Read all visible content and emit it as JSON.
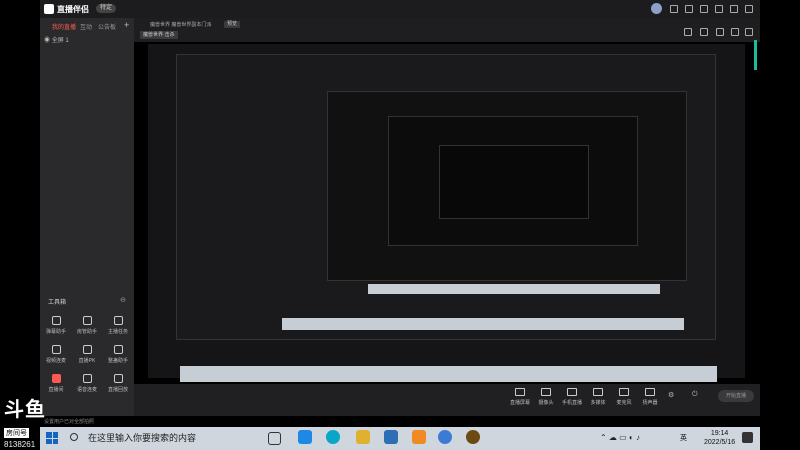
{
  "app": {
    "name": "直播伴侣",
    "version_badge": "特定",
    "preview_badge": "预览"
  },
  "left_tabs": [
    "我的直播",
    "互动",
    "公告板"
  ],
  "scene": {
    "label": "全屏 1"
  },
  "tools_title": "工具箱",
  "tools": [
    {
      "label": "弹幕助手",
      "icon": "danmaku-icon"
    },
    {
      "label": "房管助手",
      "icon": "admin-icon"
    },
    {
      "label": "主播任务",
      "icon": "task-icon"
    },
    {
      "label": "视频连麦",
      "icon": "video-link-icon"
    },
    {
      "label": "直播PK",
      "icon": "pk-icon"
    },
    {
      "label": "整蛊助手",
      "icon": "prank-icon"
    },
    {
      "label": "直播间",
      "icon": "live-room-icon",
      "accent": true
    },
    {
      "label": "语音连麦",
      "icon": "voice-link-icon"
    },
    {
      "label": "直播回放",
      "icon": "replay-icon"
    }
  ],
  "header": {
    "scene_chip": "魔兽世界·击杀",
    "stream_title": "魔兽世界 魔兽世界副本门派"
  },
  "bottom_tools": [
    {
      "label": "直播屏幕",
      "icon": "screen-icon"
    },
    {
      "label": "摄像头",
      "icon": "camera-icon"
    },
    {
      "label": "手机直播",
      "icon": "phone-icon"
    },
    {
      "label": "多媒体",
      "icon": "media-icon"
    },
    {
      "label": "麦克风",
      "icon": "mic-icon"
    },
    {
      "label": "扬声器",
      "icon": "speaker-icon"
    }
  ],
  "start_live": "开始直播",
  "status_line": "设置用户已对全部拍照",
  "watermark": {
    "brand": "斗鱼",
    "sub": "房间号",
    "room": "8138261"
  },
  "taskbar": {
    "search_placeholder": "在这里输入你要搜索的内容",
    "lang": "英",
    "time": "19:14",
    "date": "2022/5/16"
  },
  "colors": {
    "accent": "#ff5a4f",
    "scroll": "#1abc9c",
    "taskbar": "#cfd6de"
  }
}
